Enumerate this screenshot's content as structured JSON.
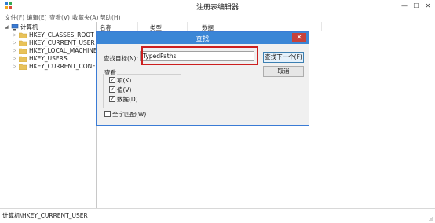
{
  "window": {
    "title": "注册表编辑器",
    "minimize_glyph": "—",
    "maximize_glyph": "☐",
    "close_glyph": "✕"
  },
  "menu": [
    "文件(F)",
    "编辑(E)",
    "查看(V)",
    "收藏夹(A)",
    "帮助(H)"
  ],
  "tree": {
    "root": "计算机",
    "children": [
      "HKEY_CLASSES_ROOT",
      "HKEY_CURRENT_USER",
      "HKEY_LOCAL_MACHINE",
      "HKEY_USERS",
      "HKEY_CURRENT_CONFIG"
    ]
  },
  "list_columns": [
    "名称",
    "类型",
    "数据"
  ],
  "status": "计算机\\HKEY_CURRENT_USER",
  "dialog": {
    "title": "查找",
    "close_glyph": "✕",
    "find_label": "查找目标(N):",
    "find_value": "TypedPaths",
    "find_next": "查找下一个(F)",
    "cancel": "取消",
    "look_at_title": "查看",
    "options": [
      {
        "label": "项(K)",
        "checked": true
      },
      {
        "label": "值(V)",
        "checked": true
      },
      {
        "label": "数据(D)",
        "checked": true
      }
    ],
    "match_whole": {
      "label": "全字匹配(W)",
      "checked": false
    }
  },
  "colors": {
    "dialog_title": "#3b86d6",
    "close_button": "#c7413a",
    "highlight": "#cc1f1f",
    "folder": "#e8c25a"
  },
  "icons": {
    "app": "registry-icon",
    "folder": "folder-icon",
    "computer": "computer-icon"
  }
}
